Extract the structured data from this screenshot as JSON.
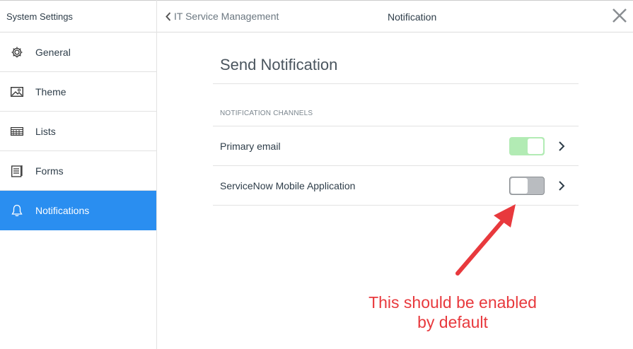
{
  "sidebar": {
    "title": "System Settings",
    "items": [
      {
        "label": "General",
        "icon": "gear-icon"
      },
      {
        "label": "Theme",
        "icon": "image-icon"
      },
      {
        "label": "Lists",
        "icon": "list-icon"
      },
      {
        "label": "Forms",
        "icon": "form-icon"
      },
      {
        "label": "Notifications",
        "icon": "bell-icon",
        "active": true
      }
    ]
  },
  "header": {
    "back_label": "IT Service Management",
    "title": "Notification"
  },
  "main": {
    "title": "Send Notification",
    "section": "NOTIFICATION CHANNELS",
    "channels": [
      {
        "label": "Primary email",
        "enabled": true
      },
      {
        "label": "ServiceNow Mobile Application",
        "enabled": false
      }
    ]
  },
  "annotation": {
    "line1": "This should be enabled",
    "line2": "by default",
    "color": "#e8393d"
  },
  "colors": {
    "accent": "#2a8ef0",
    "toggle_on": "#b2ebb4"
  }
}
